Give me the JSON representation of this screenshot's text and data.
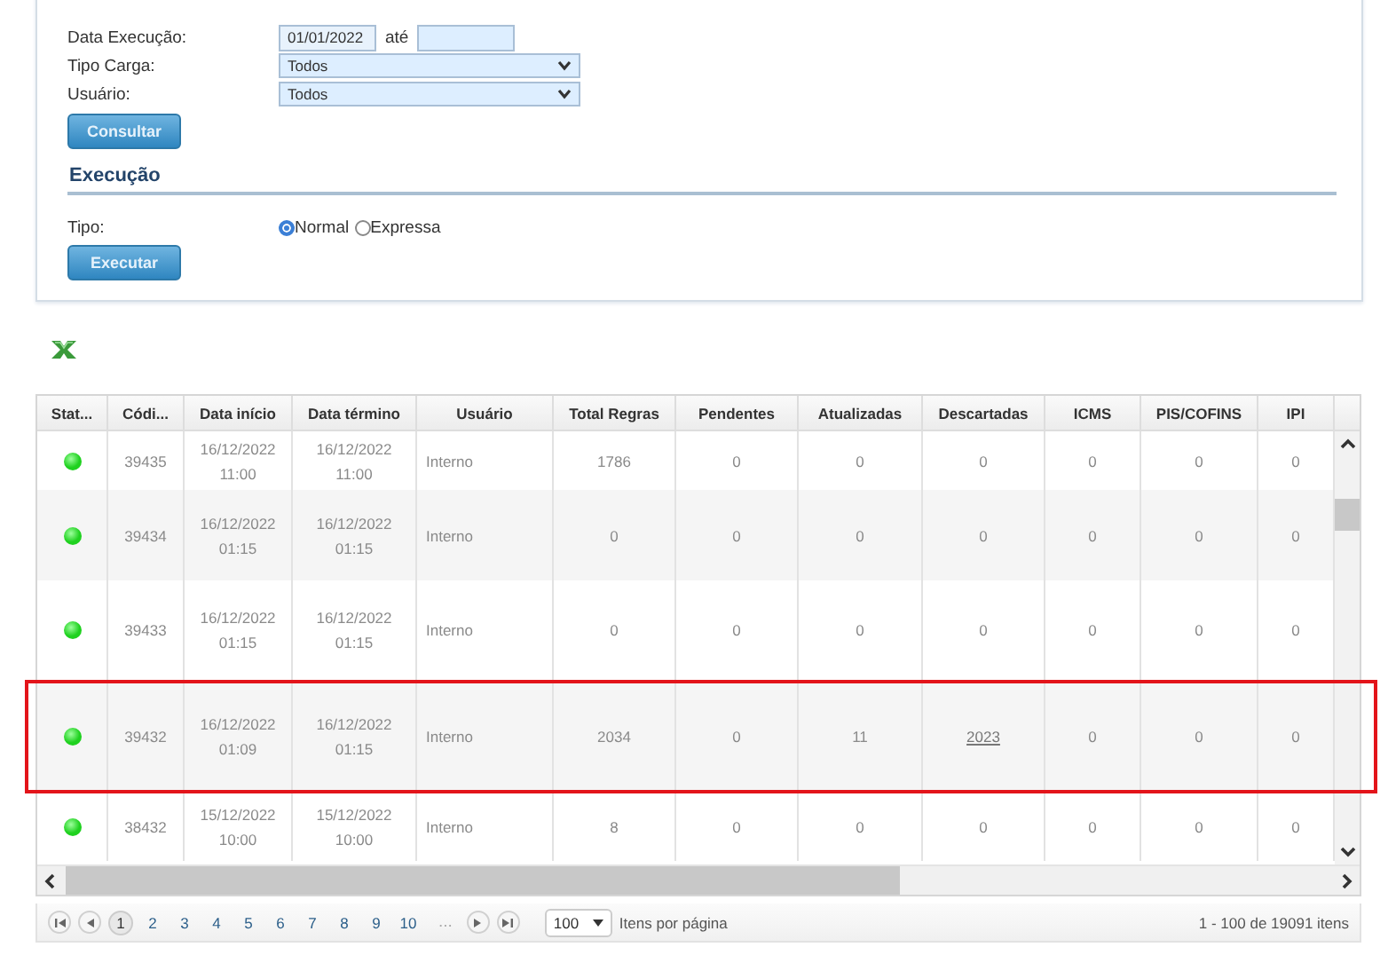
{
  "filters": {
    "fields": [
      {
        "kind": "daterange",
        "label": "Data Execução:",
        "value": "01/01/2022",
        "separator": "até"
      },
      {
        "kind": "select",
        "label": "Tipo Carga:",
        "value": "Todos"
      },
      {
        "kind": "select",
        "label": "Usuário:",
        "value": "Todos"
      }
    ],
    "button": "Consultar"
  },
  "execution": {
    "heading": "Execução",
    "label": "Tipo:",
    "options": [
      {
        "label": "Normal",
        "selected": true
      },
      {
        "label": "Expressa",
        "selected": false
      }
    ],
    "button": "Executar"
  },
  "table": {
    "columns": [
      "Stat...",
      "Códi...",
      "Data início",
      "Data término",
      "Usuário",
      "Total Regras",
      "Pendentes",
      "Atualizadas",
      "Descartadas",
      "ICMS",
      "PIS/COFINS",
      "IPI"
    ],
    "rows": [
      {
        "color": "#1fd11f",
        "highlighted": false,
        "cells": [
          "",
          "39435",
          "16/12/2022 11:00",
          "16/12/2022 11:00",
          "Interno",
          "1786",
          "0",
          "0",
          "0",
          "0",
          "0",
          "0"
        ]
      },
      {
        "color": "#1fd11f",
        "highlighted": false,
        "cells": [
          "",
          "39434",
          "16/12/2022 01:15",
          "16/12/2022 01:15",
          "Interno",
          "0",
          "0",
          "0",
          "0",
          "0",
          "0",
          "0"
        ]
      },
      {
        "color": "#1fd11f",
        "highlighted": false,
        "cells": [
          "",
          "39433",
          "16/12/2022 01:15",
          "16/12/2022 01:15",
          "Interno",
          "0",
          "0",
          "0",
          "0",
          "0",
          "0",
          "0"
        ]
      },
      {
        "color": "#1fd11f",
        "highlighted": true,
        "cells": [
          "",
          "39432",
          "16/12/2022 01:09",
          "16/12/2022 01:15",
          "Interno",
          "2034",
          "0",
          "11",
          {
            "text": "2023",
            "link": true
          },
          "0",
          "0",
          "0"
        ]
      },
      {
        "color": "#1fd11f",
        "highlighted": false,
        "cells": [
          "",
          "38432",
          "15/12/2022 10:00",
          "15/12/2022 10:00",
          "Interno",
          "8",
          "0",
          "0",
          "0",
          "0",
          "0",
          "0"
        ]
      }
    ]
  },
  "pager": {
    "pages": [
      {
        "label": "1",
        "selected": true
      },
      {
        "label": "2",
        "selected": false
      },
      {
        "label": "3",
        "selected": false
      },
      {
        "label": "4",
        "selected": false
      },
      {
        "label": "5",
        "selected": false
      },
      {
        "label": "6",
        "selected": false
      },
      {
        "label": "7",
        "selected": false
      },
      {
        "label": "8",
        "selected": false
      },
      {
        "label": "9",
        "selected": false
      },
      {
        "label": "10",
        "selected": false
      }
    ],
    "more": "...",
    "page_size": "100",
    "page_size_label": "Itens por página",
    "summary": "1 - 100 de 19091 itens"
  }
}
